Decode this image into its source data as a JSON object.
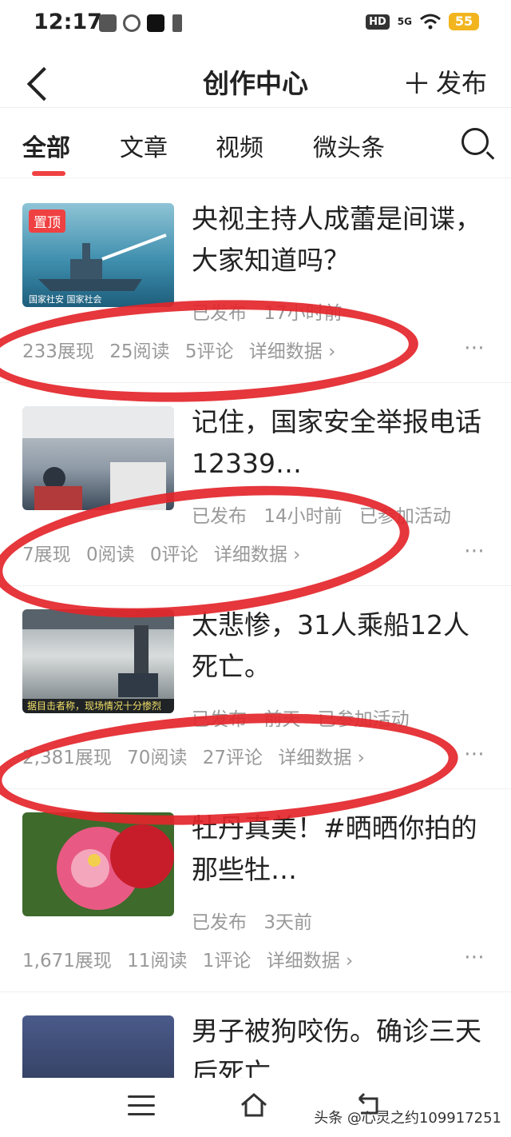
{
  "status_bar": {
    "time": "12:17",
    "network": "5G",
    "hd": "HD",
    "battery": "55"
  },
  "header": {
    "title": "创作中心",
    "publish_label": "发布"
  },
  "tabs": [
    "全部",
    "文章",
    "视频",
    "微头条"
  ],
  "thumb_texts": [
    "国家社安 国家社会",
    "据目击者称，现场情况十分惨烈"
  ],
  "items": [
    {
      "pinned": "置顶",
      "title": "央视主持人成蕾是间谍，大家知道吗？",
      "status": "已发布",
      "time": "17小时前",
      "activity": "",
      "impressions": "233展现",
      "reads": "25阅读",
      "comments": "5评论",
      "details": "详细数据 ›"
    },
    {
      "pinned": "",
      "title": "记住，国家安全举报电话12339…",
      "status": "已发布",
      "time": "14小时前",
      "activity": "已参加活动",
      "impressions": "7展现",
      "reads": "0阅读",
      "comments": "0评论",
      "details": "详细数据 ›"
    },
    {
      "pinned": "",
      "title": "太悲惨，31人乘船12人死亡。",
      "status": "已发布",
      "time": "前天",
      "activity": "已参加活动",
      "impressions": "2,381展现",
      "reads": "70阅读",
      "comments": "27评论",
      "details": "详细数据 ›"
    },
    {
      "pinned": "",
      "title": "牡丹真美！#晒晒你拍的那些牡…",
      "status": "已发布",
      "time": "3天前",
      "activity": "",
      "impressions": "1,671展现",
      "reads": "11阅读",
      "comments": "1评论",
      "details": "详细数据 ›"
    },
    {
      "pinned": "",
      "title": "男子被狗咬伤。确诊三天后死亡",
      "status": "",
      "time": "",
      "activity": "",
      "impressions": "",
      "reads": "",
      "comments": "",
      "details": ""
    }
  ],
  "more_icon": "⋯",
  "watermark": "头条 @心灵之约109917251",
  "colors": {
    "accent": "#f04142",
    "annotation_red": "#e3262b"
  }
}
